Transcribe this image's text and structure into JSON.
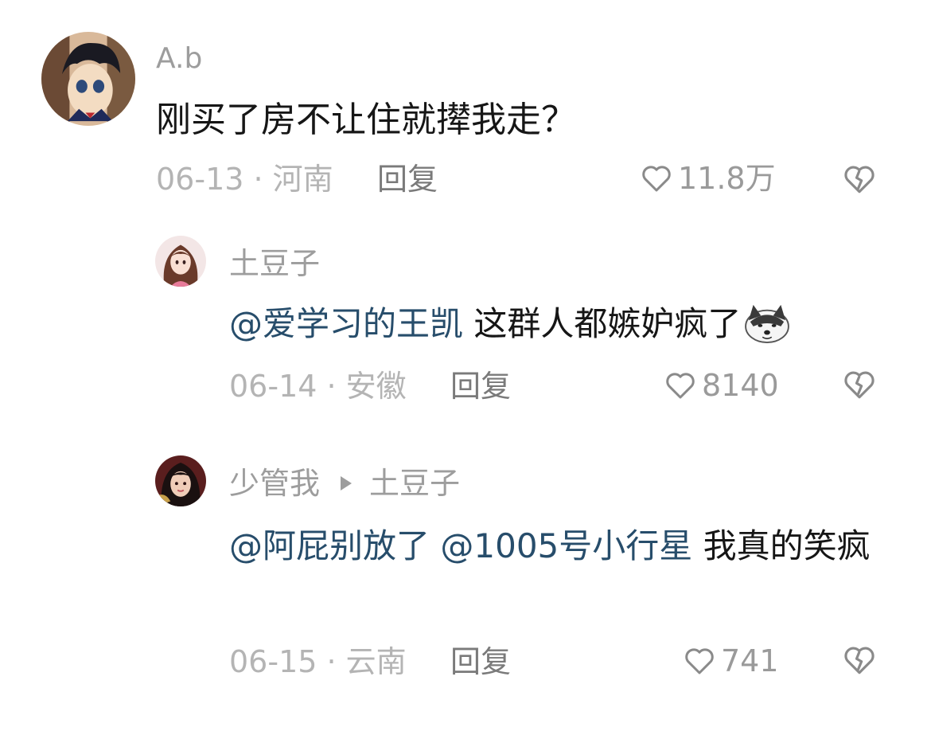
{
  "comments": [
    {
      "name": "A.b",
      "text": "刚买了房不让住就撵我走？",
      "date": "06-13",
      "location": "河南",
      "reply_label": "回复",
      "likes": "11.8万"
    },
    {
      "name": "土豆子",
      "mention": "@爱学习的王凯",
      "text": " 这群人都嫉妒疯了",
      "emoji": "doge-emoji",
      "date": "06-14",
      "location": "安徽",
      "reply_label": "回复",
      "likes": "8140"
    },
    {
      "name": "少管我",
      "reply_to": "土豆子",
      "mention1": "@阿屁别放了",
      "mention2": "@1005号小行星",
      "text": " 我真的笑疯",
      "date": "06-15",
      "location": "云南",
      "reply_label": "回复",
      "likes": "741"
    }
  ],
  "colors": {
    "mention": "#274d6b",
    "meta": "#b4b4b4",
    "name": "#9d9d9d"
  },
  "icons": [
    "heart-outline-icon",
    "broken-heart-icon",
    "reply-arrow-icon"
  ]
}
